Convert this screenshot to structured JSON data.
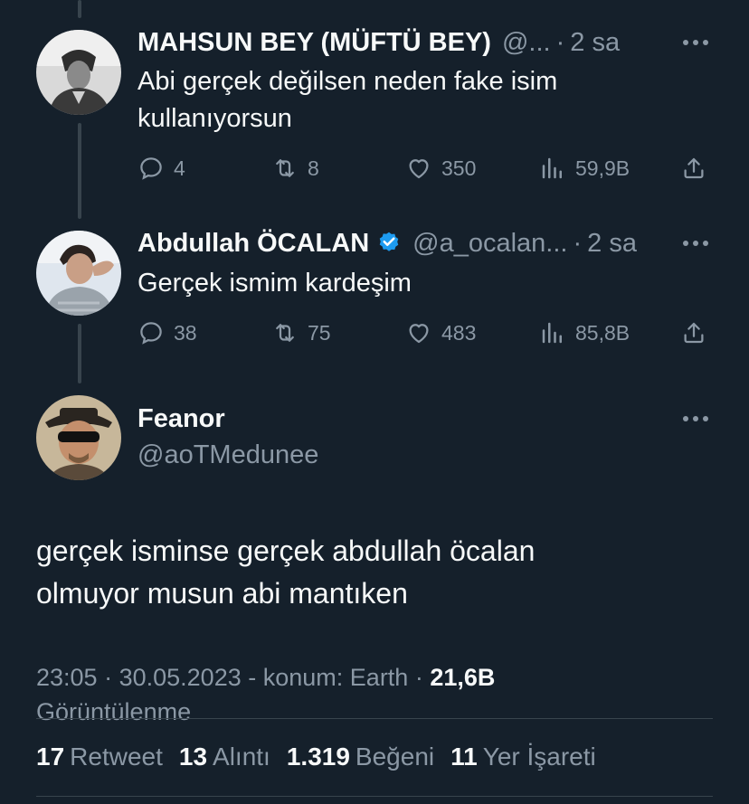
{
  "tweets": [
    {
      "name": "MAHSUN BEY (MÜFTÜ BEY)",
      "handle": "@...",
      "time": "2 sa",
      "text": "Abi gerçek değilsen neden fake isim kullanıyorsun",
      "replies": "4",
      "retweets": "8",
      "likes": "350",
      "views": "59,9B"
    },
    {
      "name": "Abdullah ÖCALAN",
      "handle": "@a_ocalan...",
      "time": "2 sa",
      "text": "Gerçek ismim kardeşim",
      "replies": "38",
      "retweets": "75",
      "likes": "483",
      "views": "85,8B"
    }
  ],
  "main": {
    "name": "Feanor",
    "handle": "@aoTMedunee",
    "text_line1": "gerçek isminse gerçek abdullah öcalan",
    "text_line2": "olmuyor musun abi mantıken",
    "time": "23:05",
    "date": "30.05.2023",
    "location": "konum: Earth",
    "views": "21,6B",
    "views_label": "Görüntülenme",
    "stats": {
      "retweets": "17",
      "retweets_label": "Retweet",
      "quotes": "13",
      "quotes_label": "Alıntı",
      "likes": "1.319",
      "likes_label": "Beğeni",
      "bookmarks": "11",
      "bookmarks_label": "Yer İşareti"
    }
  },
  "colors": {
    "background": "#15202b",
    "text_primary": "#f7f9f9",
    "text_secondary": "#8b98a5",
    "verified": "#1d9bf0",
    "divider": "#38444d"
  },
  "icons": [
    "reply-icon",
    "retweet-icon",
    "like-icon",
    "views-icon",
    "share-icon",
    "more-icon",
    "verified-icon"
  ]
}
